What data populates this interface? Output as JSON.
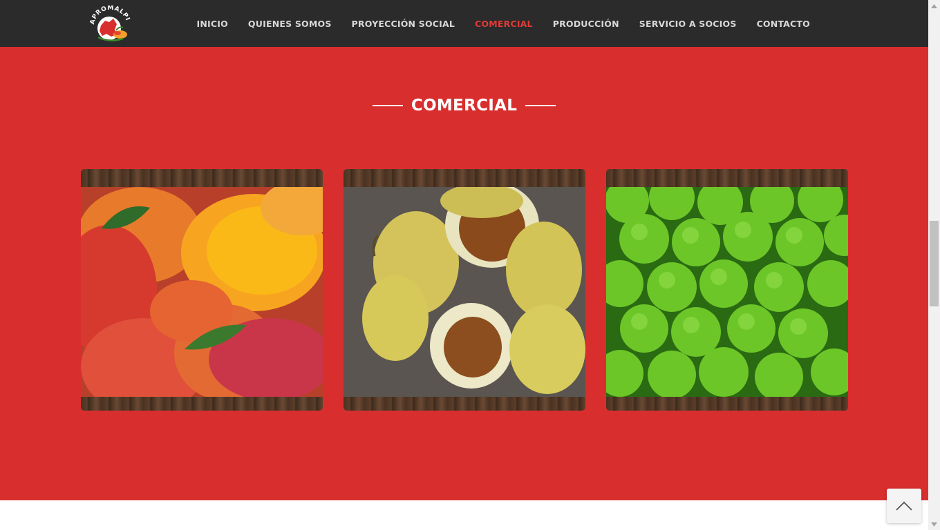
{
  "header": {
    "logo_text": "APROMALPI",
    "nav": [
      {
        "label": "INICIO",
        "active": false
      },
      {
        "label": "QUIENES SOMOS",
        "active": false
      },
      {
        "label": "PROYECCIÓN SOCIAL",
        "active": false
      },
      {
        "label": "COMERCIAL",
        "active": true
      },
      {
        "label": "PRODUCCIÓN",
        "active": false
      },
      {
        "label": "SERVICIO A SOCIOS",
        "active": false
      },
      {
        "label": "CONTACTO",
        "active": false
      }
    ]
  },
  "section": {
    "title": "COMERCIAL",
    "products": [
      {
        "name": "mango",
        "icon": "mango-photo"
      },
      {
        "name": "passion-fruit",
        "icon": "passion-fruit-photo"
      },
      {
        "name": "lime",
        "icon": "lime-photo"
      }
    ]
  },
  "colors": {
    "header_bg": "#2b2b2b",
    "section_bg": "#d92e2e",
    "active_nav": "#e03c38"
  },
  "controls": {
    "back_to_top_icon": "chevron-up-icon"
  }
}
